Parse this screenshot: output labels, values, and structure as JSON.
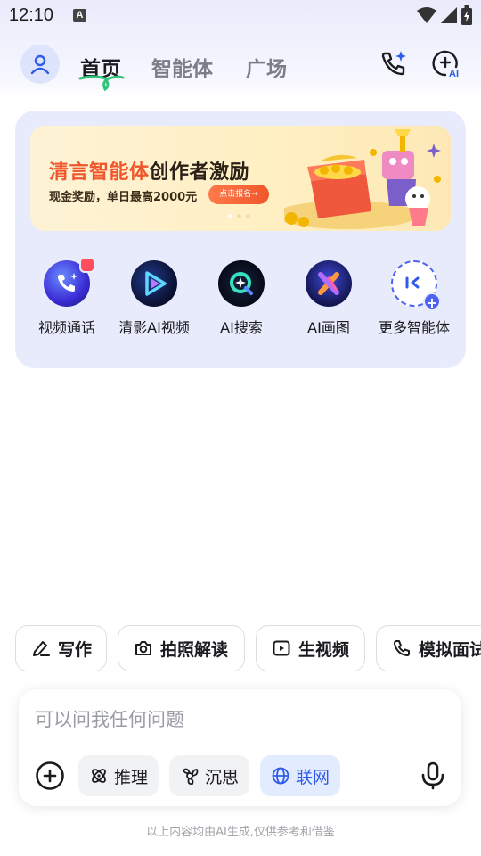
{
  "status_bar": {
    "time": "12:10",
    "notification_glyph": "A"
  },
  "header": {
    "tabs": [
      {
        "label": "首页",
        "active": true
      },
      {
        "label": "智能体",
        "active": false
      },
      {
        "label": "广场",
        "active": false
      }
    ],
    "phone_icon": "phone-sparkle-icon",
    "ai_icon": "ai-chat-plus-icon"
  },
  "banner": {
    "title_orange": "清言智能体",
    "title_dark": "创作者激励",
    "subtitle": "现金奖励，单日最高2000元",
    "cta": "点击报名→",
    "dots": 3,
    "active_dot": 0
  },
  "shortcuts": [
    {
      "label": "视频通话",
      "icon": "video-call-icon"
    },
    {
      "label": "清影AI视频",
      "icon": "qingying-video-icon"
    },
    {
      "label": "AI搜索",
      "icon": "ai-search-icon"
    },
    {
      "label": "AI画图",
      "icon": "ai-drawing-icon"
    },
    {
      "label": "更多智能体",
      "icon": "more-agents-icon"
    }
  ],
  "chips": [
    {
      "label": "写作",
      "icon": "pen-icon"
    },
    {
      "label": "拍照解读",
      "icon": "camera-icon"
    },
    {
      "label": "生视频",
      "icon": "play-icon"
    },
    {
      "label": "模拟面试",
      "icon": "phone-icon"
    }
  ],
  "input": {
    "placeholder": "可以问我任何问题",
    "modes": [
      {
        "label": "推理",
        "active": false,
        "icon": "reasoning-icon"
      },
      {
        "label": "沉思",
        "active": false,
        "icon": "contemplate-icon"
      },
      {
        "label": "联网",
        "active": true,
        "icon": "globe-icon"
      }
    ]
  },
  "disclaimer": "以上内容均由AI生成,仅供参考和借鉴",
  "colors": {
    "accent": "#2f5bea",
    "banner_orange": "#f0562b",
    "card_bg": "#e8ebfb"
  }
}
